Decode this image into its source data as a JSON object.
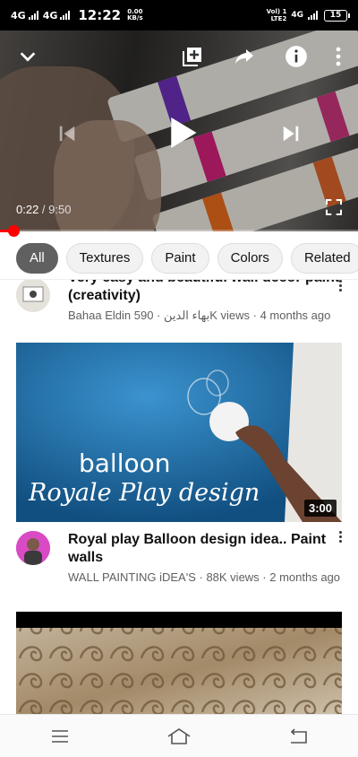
{
  "status_bar": {
    "net1": "4G",
    "net2": "4G",
    "time": "12:22",
    "speed_value": "0.00",
    "speed_unit": "KB/s",
    "volte_line1": "Vol) 1",
    "volte_line2": "LTE2",
    "net3": "4G",
    "battery": "15"
  },
  "player": {
    "current_time": "0:22",
    "separator": " / ",
    "duration": "9:50",
    "progress_fraction": 0.037,
    "icons": [
      "chevron-down-icon",
      "add-to-playlist-icon",
      "share-icon",
      "info-icon",
      "more-vert-icon",
      "previous-icon",
      "play-icon",
      "next-icon",
      "fullscreen-icon"
    ]
  },
  "chips": [
    "All",
    "Textures",
    "Paint",
    "Colors",
    "Related"
  ],
  "videos": [
    {
      "title": "Very easy and beautiful wall decor paint (creativity)",
      "channel": "Bahaa Eldin بهاء الدين",
      "views": "590K views",
      "age": "4 months ago"
    },
    {
      "thumb_line1": "balloon",
      "thumb_line2": "Royale Play design",
      "duration": "3:00",
      "title": "Royal play Balloon design idea..  Paint walls",
      "channel": "WALL PAINTING iDEA'S",
      "views": "88K views",
      "age": "2 months ago"
    }
  ],
  "colors": {
    "accent": "#ff0000",
    "chip_active": "#606060",
    "thumb_blue": "#1f6ea8"
  },
  "nav": [
    "menu-icon",
    "home-icon",
    "back-icon"
  ]
}
